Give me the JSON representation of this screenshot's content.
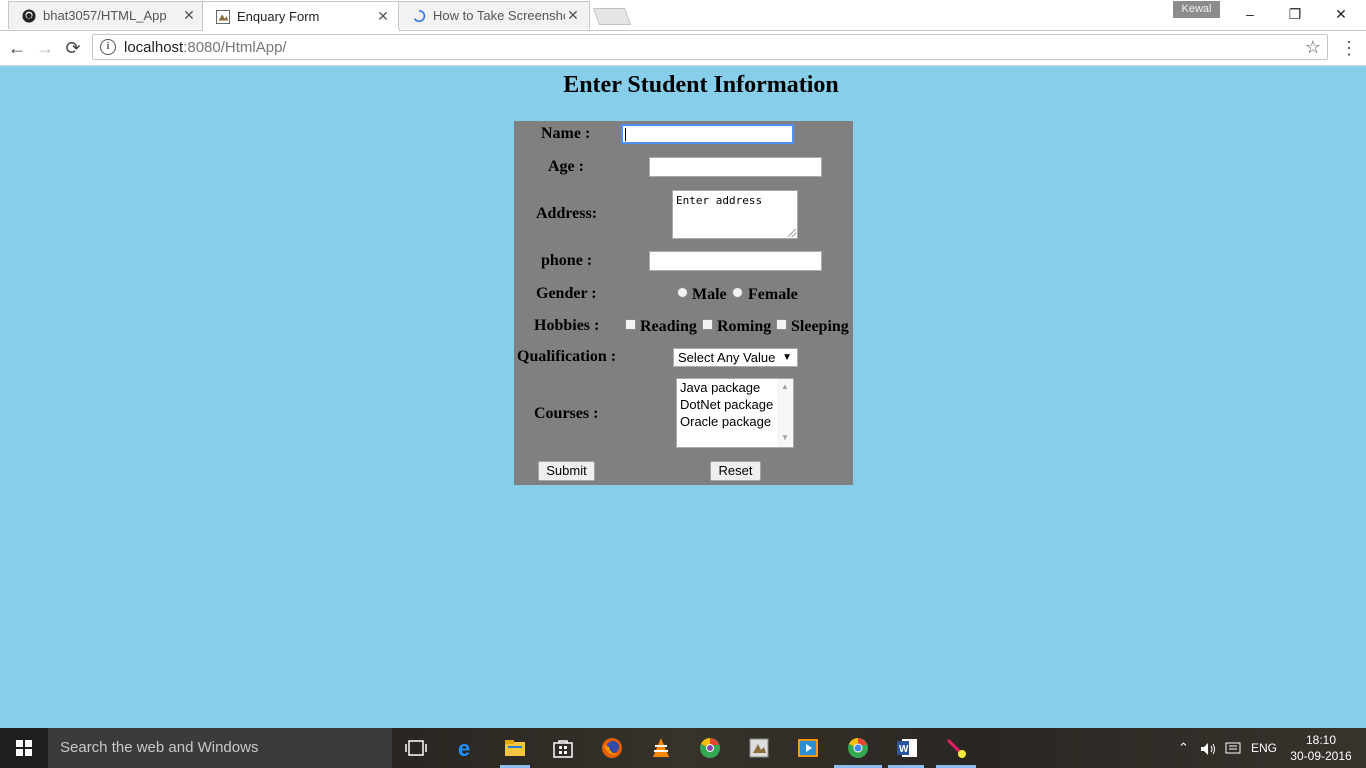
{
  "browser": {
    "tabs": [
      {
        "title": "bhat3057/HTML_App",
        "icon": "github-icon",
        "active": false
      },
      {
        "title": "Enquary Form",
        "icon": "page-favicon-icon",
        "active": true
      },
      {
        "title": "How to Take Screenshots",
        "icon": "loading-spinner-icon",
        "active": false
      }
    ],
    "user_badge": "Kewal",
    "window_controls": {
      "minimize": "–",
      "restore": "❐",
      "close": "✕"
    },
    "address": {
      "host": "localhost",
      "path": ":8080/HtmlApp/"
    },
    "nav": {
      "back": "←",
      "forward": "→",
      "reload": "⟳",
      "star": "☆",
      "menu": "⋮",
      "info": "i"
    }
  },
  "page": {
    "title": "Enter Student Information",
    "form": {
      "name_label": "Name :",
      "age_label": "Age :",
      "address_label": "Address:",
      "address_value": "Enter address",
      "phone_label": "phone :",
      "gender_label": "Gender :",
      "gender_options": [
        "Male",
        "Female"
      ],
      "hobbies_label": "Hobbies :",
      "hobby_options": [
        "Reading",
        "Roming",
        "Sleeping"
      ],
      "qualification_label": "Qualification :",
      "qualification_value": "Select Any Value",
      "courses_label": "Courses :",
      "course_options": [
        "Java package",
        "DotNet package",
        "Oracle package"
      ],
      "submit_label": "Submit",
      "reset_label": "Reset"
    }
  },
  "taskbar": {
    "search_placeholder": "Search the web and Windows",
    "apps": [
      "task-view-icon",
      "edge-icon",
      "file-explorer-icon",
      "store-icon",
      "firefox-icon",
      "vlc-icon",
      "chrome-color-icon",
      "paint-icon",
      "media-player-icon",
      "chrome-icon",
      "word-icon",
      "tool-icon"
    ],
    "tray": {
      "language": "ENG",
      "time": "18:10",
      "date": "30-09-2016"
    }
  },
  "colors": {
    "page_background": "#87ceeb",
    "form_background": "#808080",
    "focus_border": "#4d90fe"
  }
}
